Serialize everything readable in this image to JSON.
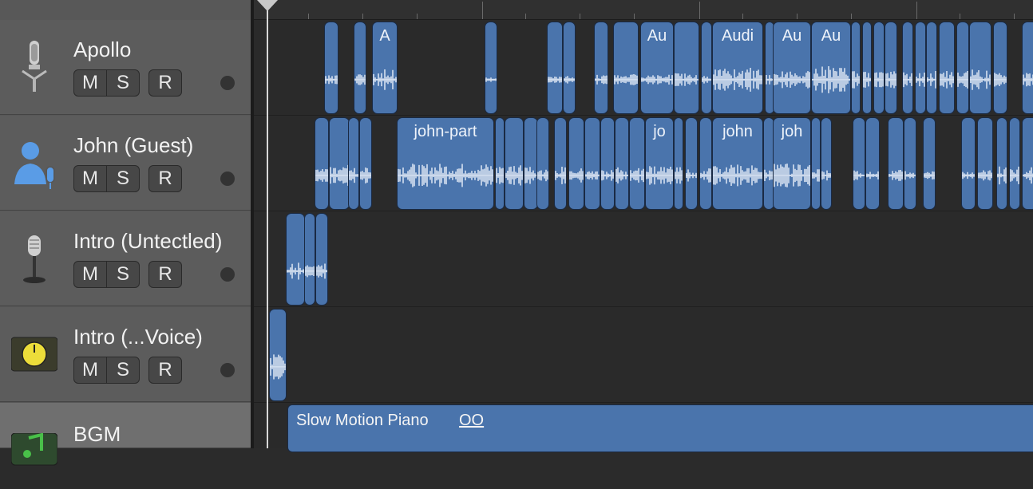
{
  "tracks": [
    {
      "name": "Apollo",
      "icon": "studio-mic-icon",
      "m": "M",
      "s": "S",
      "r": "R"
    },
    {
      "name": "John (Guest)",
      "icon": "person-mic-icon",
      "m": "M",
      "s": "S",
      "r": "R"
    },
    {
      "name": "Intro (Untectled)",
      "icon": "vintage-mic-icon",
      "m": "M",
      "s": "S",
      "r": "R"
    },
    {
      "name": "Intro (...Voice)",
      "icon": "yellow-knob-icon",
      "m": "M",
      "s": "S",
      "r": "R"
    },
    {
      "name": "BGM",
      "icon": "music-note-icon"
    }
  ],
  "regions": {
    "apollo_labels": [
      "A",
      "Au",
      "Audi",
      "Au",
      "Au"
    ],
    "john_labels": [
      "john-part",
      "jo",
      "john",
      "joh"
    ],
    "bgm_label": "Slow Motion Piano",
    "bgm_loop": "OO"
  },
  "colors": {
    "region": "#4a74ac",
    "region_border": "#1a2a44",
    "header": "#5c5c5c",
    "timeline": "#2a2a2a"
  }
}
